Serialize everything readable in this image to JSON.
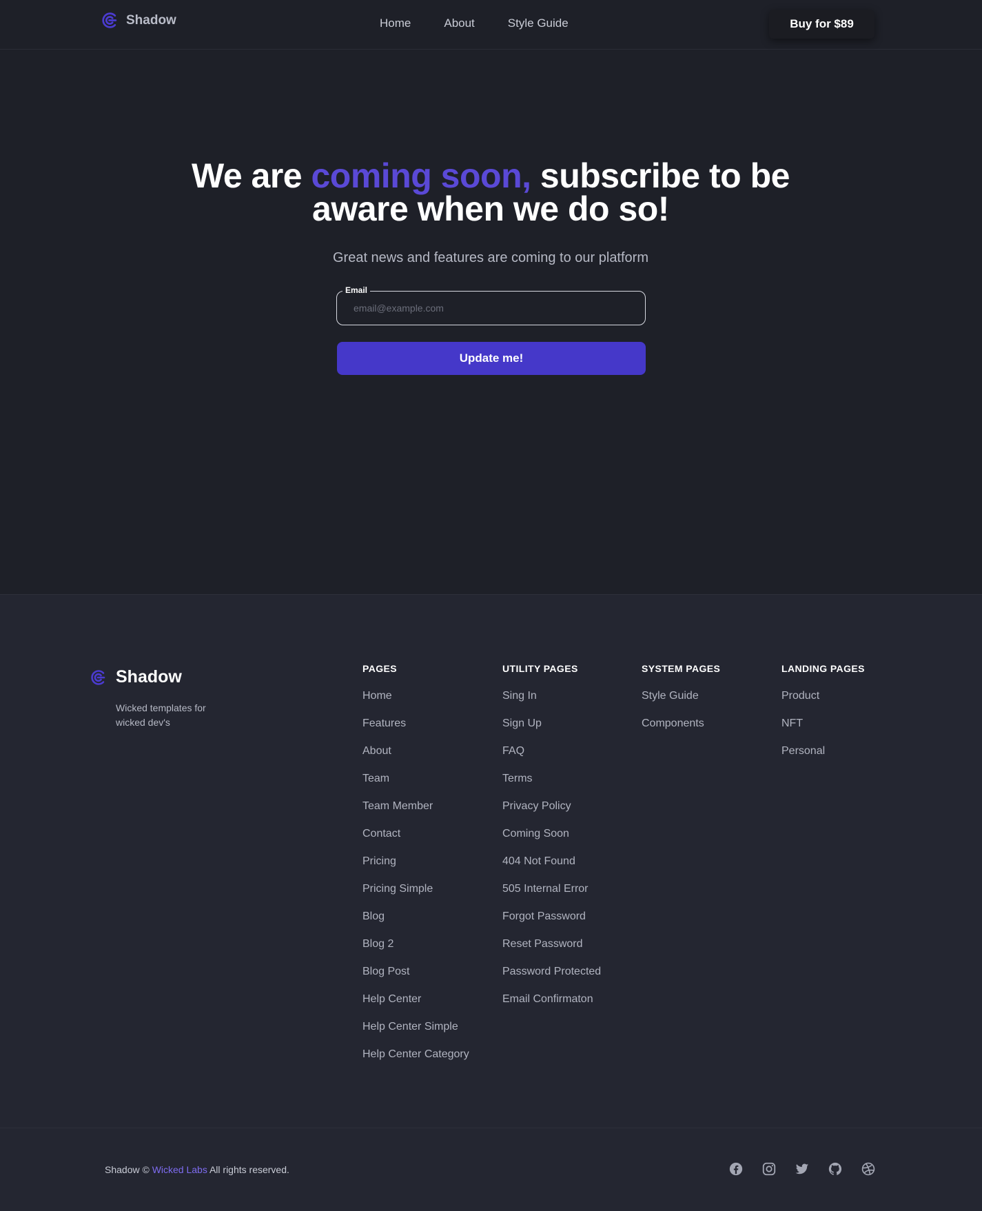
{
  "brand": {
    "name": "Shadow"
  },
  "nav": {
    "links": [
      "Home",
      "About",
      "Style Guide"
    ],
    "buy_label": "Buy for $89"
  },
  "hero": {
    "title_part1": "We are ",
    "title_accent": "coming soon,",
    "title_part2": " subscribe to be aware when we do so!",
    "subtitle": "Great news and features are coming to our platform",
    "email_label": "Email",
    "email_placeholder": "email@example.com",
    "email_value": "",
    "submit_label": "Update me!"
  },
  "footer": {
    "brand_name": "Shadow",
    "tagline": "Wicked templates for wicked dev's",
    "columns": [
      {
        "title": "PAGES",
        "links": [
          "Home",
          "Features",
          "About",
          "Team",
          "Team Member",
          "Contact",
          "Pricing",
          "Pricing Simple",
          "Blog",
          "Blog 2",
          "Blog Post",
          "Help Center",
          "Help Center Simple",
          "Help Center Category"
        ]
      },
      {
        "title": "UTILITY PAGES",
        "links": [
          "Sing In",
          "Sign Up",
          "FAQ",
          "Terms",
          "Privacy Policy",
          "Coming Soon",
          "404 Not Found",
          "505 Internal Error",
          "Forgot Password",
          "Reset Password",
          "Password Protected",
          "Email Confirmaton"
        ]
      },
      {
        "title": "SYSTEM PAGES",
        "links": [
          "Style Guide",
          "Components"
        ]
      },
      {
        "title": "LANDING PAGES",
        "links": [
          "Product",
          "NFT",
          "Personal"
        ]
      }
    ]
  },
  "bottom": {
    "copy_prefix": "Shadow © ",
    "copy_link": "Wicked Labs",
    "copy_suffix": " All rights reserved.",
    "socials": [
      "facebook-icon",
      "instagram-icon",
      "twitter-icon",
      "github-icon",
      "dribbble-icon"
    ]
  },
  "colors": {
    "background": "#1e2028",
    "footer_background": "#242631",
    "accent": "#5a49d6",
    "button": "#4538c9",
    "link_accent": "#7e6cf0"
  }
}
